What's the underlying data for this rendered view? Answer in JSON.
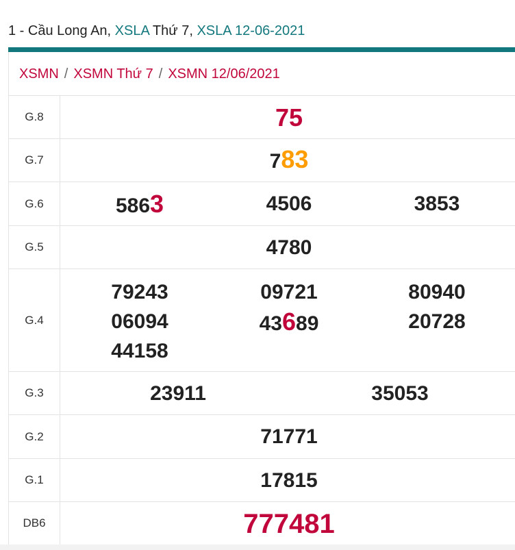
{
  "header": {
    "prefix": "1 - Cầu Long An, ",
    "link1": "XSLA",
    "mid": " Thứ 7, ",
    "link2": "XSLA 12-06-2021"
  },
  "breadcrumb": {
    "items": [
      "XSMN",
      "XSMN Thứ 7",
      "XSMN 12/06/2021"
    ],
    "separator": "/"
  },
  "colors": {
    "accent_teal": "#13787d",
    "highlight_red": "#c1063b",
    "highlight_orange": "#ff9c00"
  },
  "results": {
    "g8": {
      "label": "G.8",
      "value": "75"
    },
    "g7": {
      "label": "G.7",
      "pre": "7",
      "hl": "83"
    },
    "g6": {
      "label": "G.6",
      "v1_pre": "586",
      "v1_hl": "3",
      "v2": "4506",
      "v3": "3853"
    },
    "g5": {
      "label": "G.5",
      "value": "4780"
    },
    "g4": {
      "label": "G.4",
      "v1": "79243",
      "v2": "09721",
      "v3": "80940",
      "v4": "06094",
      "v5_pre": "43",
      "v5_hl": "6",
      "v5_post": "89",
      "v6": "20728",
      "v7": "44158"
    },
    "g3": {
      "label": "G.3",
      "v1": "23911",
      "v2": "35053"
    },
    "g2": {
      "label": "G.2",
      "value": "71771"
    },
    "g1": {
      "label": "G.1",
      "value": "17815"
    },
    "db": {
      "label": "DB6",
      "value": "777481"
    }
  }
}
